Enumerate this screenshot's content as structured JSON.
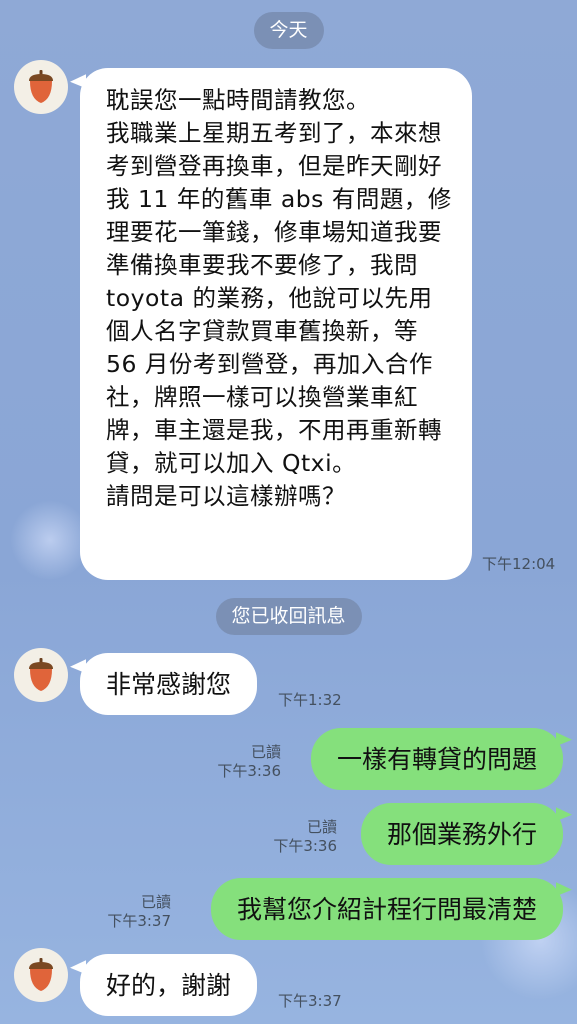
{
  "date_separator": "今天",
  "recall_notice": "您已收回訊息",
  "messages": [
    {
      "text": "耽誤您一點時間請教您。\n我職業上星期五考到了，本來想考到營登再換車，但是昨天剛好我 11 年的舊車 abs 有問題，修理要花一筆錢，修車場知道我要準備換車要我不要修了，我問 toyota 的業務，他說可以先用個人名字貸款買車舊換新，等 56 月份考到營登，再加入合作社，牌照一樣可以換營業車紅牌，車主還是我，不用再重新轉貸，就可以加入 Qtxi。\n請問是可以這樣辦嗎？",
      "time": "下午12:04"
    },
    {
      "text": "非常感謝您",
      "time": "下午1:32"
    },
    {
      "text": "一樣有轉貸的問題",
      "read": "已讀",
      "time": "下午3:36"
    },
    {
      "text": "那個業務外行",
      "read": "已讀",
      "time": "下午3:36"
    },
    {
      "text": "我幫您介紹計程行問最清楚",
      "read": "已讀",
      "time": "下午3:37"
    },
    {
      "text": "好的，謝謝",
      "time": "下午3:37"
    }
  ],
  "colors": {
    "background": "#8fa9d6",
    "incoming_bubble": "#ffffff",
    "outgoing_bubble": "#85e07c",
    "pill": "#788caf"
  },
  "icons": {
    "avatar": "acorn-icon"
  }
}
